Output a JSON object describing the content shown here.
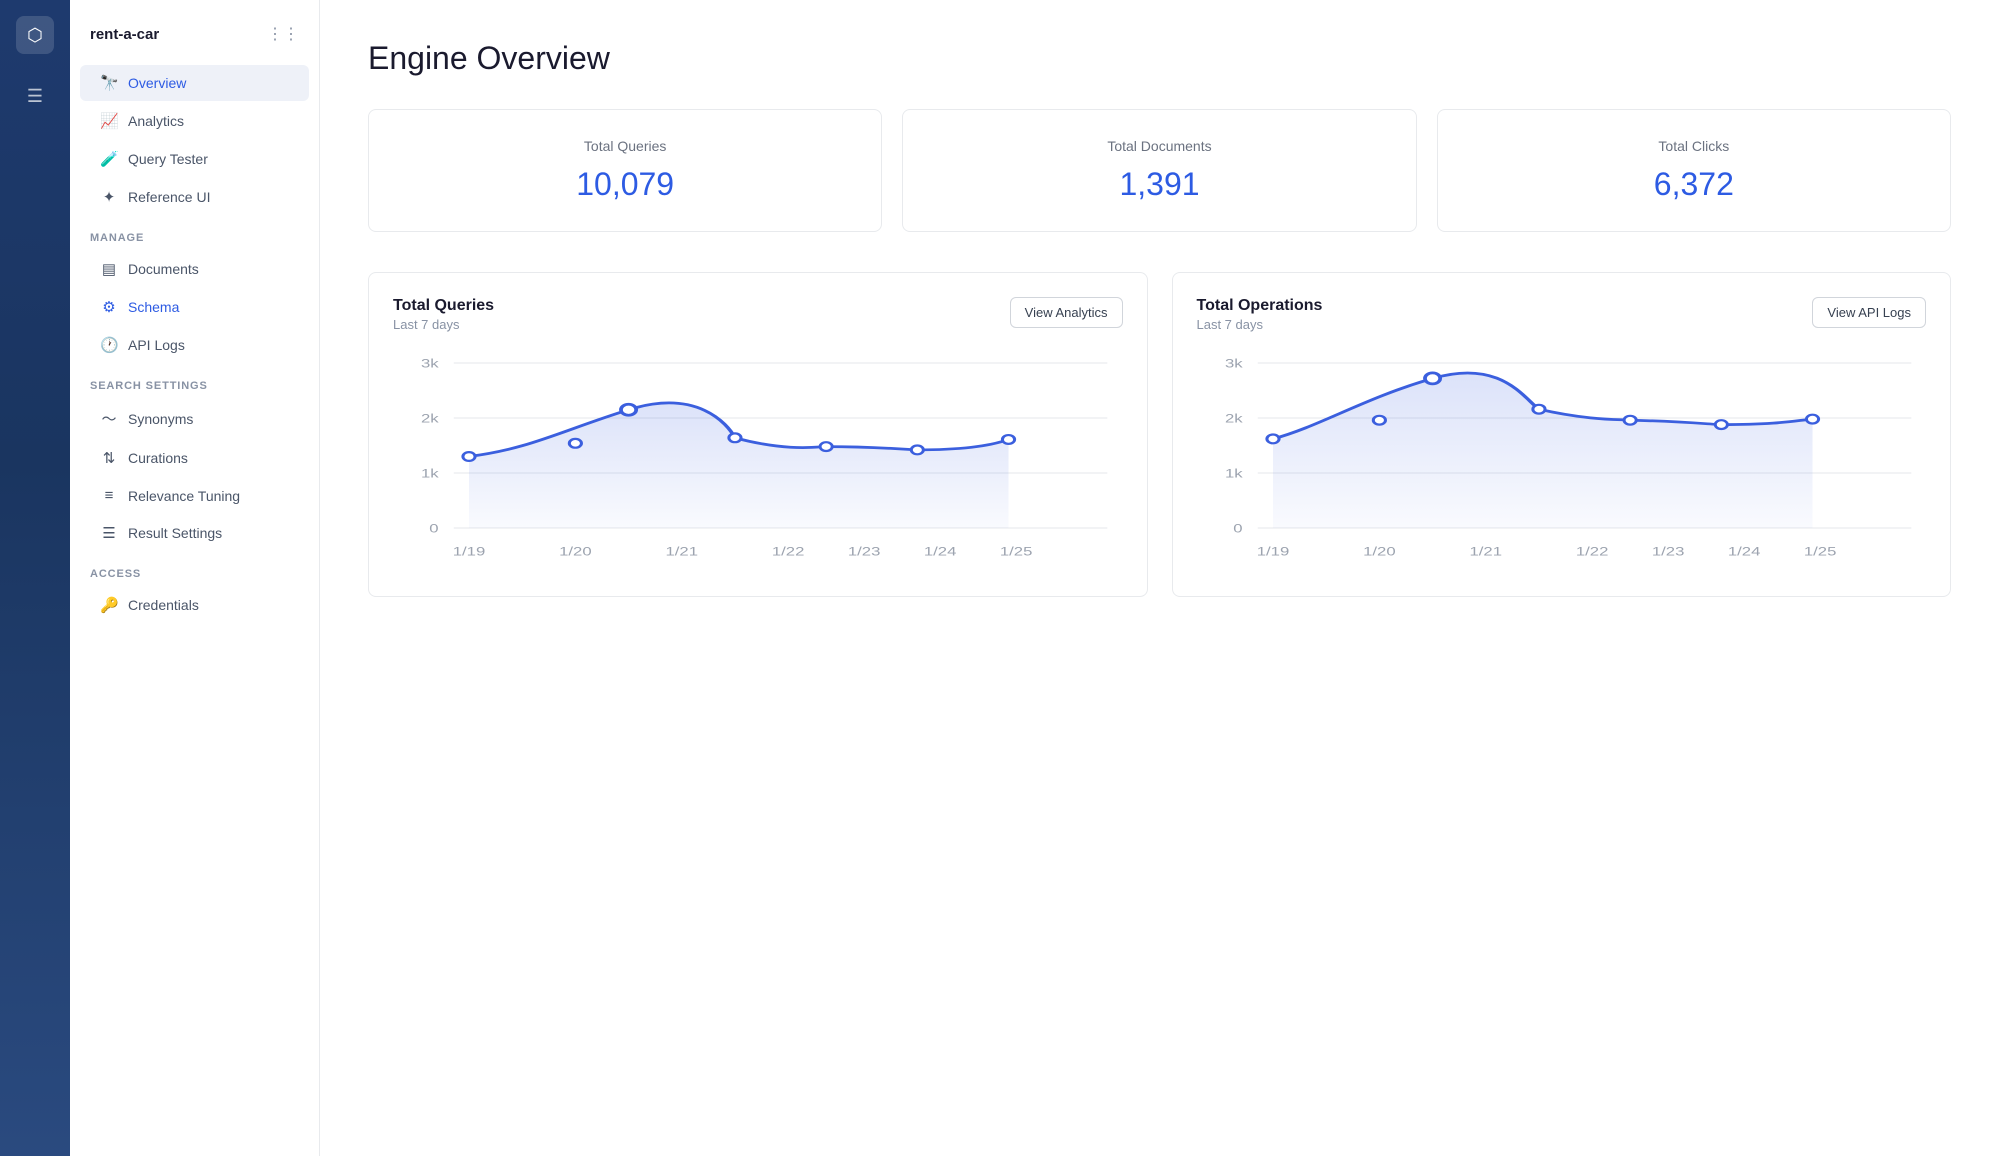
{
  "app": {
    "name": "rent-a-car"
  },
  "sidebar": {
    "title": "rent-a-car",
    "nav_items": [
      {
        "id": "overview",
        "label": "Overview",
        "icon": "binoculars",
        "active": true
      },
      {
        "id": "analytics",
        "label": "Analytics",
        "icon": "chart"
      },
      {
        "id": "query-tester",
        "label": "Query Tester",
        "icon": "flask"
      },
      {
        "id": "reference-ui",
        "label": "Reference UI",
        "icon": "sparkle"
      }
    ],
    "manage_section": "MANAGE",
    "manage_items": [
      {
        "id": "documents",
        "label": "Documents",
        "icon": "doc"
      },
      {
        "id": "schema",
        "label": "Schema",
        "icon": "gear",
        "active_secondary": true
      },
      {
        "id": "api-logs",
        "label": "API Logs",
        "icon": "clock"
      }
    ],
    "search_section": "SEARCH SETTINGS",
    "search_items": [
      {
        "id": "synonyms",
        "label": "Synonyms",
        "icon": "waves"
      },
      {
        "id": "curations",
        "label": "Curations",
        "icon": "sliders"
      },
      {
        "id": "relevance-tuning",
        "label": "Relevance Tuning",
        "icon": "tune"
      },
      {
        "id": "result-settings",
        "label": "Result Settings",
        "icon": "list"
      }
    ],
    "access_section": "ACCESS",
    "access_items": [
      {
        "id": "credentials",
        "label": "Credentials",
        "icon": "key"
      }
    ]
  },
  "main": {
    "page_title": "Engine Overview",
    "stats": [
      {
        "label": "Total Queries",
        "value": "10,079"
      },
      {
        "label": "Total Documents",
        "value": "1,391"
      },
      {
        "label": "Total Clicks",
        "value": "6,372"
      }
    ],
    "chart1": {
      "title": "Total Queries",
      "subtitle": "Last 7 days",
      "btn_label": "View Analytics",
      "x_labels": [
        "1/19",
        "1/20",
        "1/21",
        "1/22",
        "1/23",
        "1/24",
        "1/25"
      ],
      "y_labels": [
        "3k",
        "2k",
        "1k",
        "0"
      ],
      "data": [
        1300,
        1600,
        2050,
        1640,
        1480,
        1420,
        1610
      ]
    },
    "chart2": {
      "title": "Total Operations",
      "subtitle": "Last 7 days",
      "btn_label": "View API Logs",
      "x_labels": [
        "1/19",
        "1/20",
        "1/21",
        "1/22",
        "1/23",
        "1/24",
        "1/25"
      ],
      "y_labels": [
        "3k",
        "2k",
        "1k",
        "0"
      ],
      "data": [
        1620,
        2050,
        2720,
        2160,
        1960,
        1880,
        1980
      ]
    }
  }
}
